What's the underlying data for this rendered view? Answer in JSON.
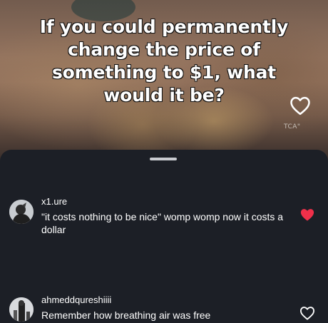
{
  "video": {
    "caption": "If you could permanently change the price of something to $1, what would it be?",
    "watermark": "TCA\"",
    "liked": false
  },
  "comments": [
    {
      "username": "x1.ure",
      "text": "\"it costs nothing to be nice\" womp womp now it costs a dollar",
      "liked": true,
      "like_icon": "heart-filled-icon",
      "like_color": "#f0304a"
    },
    {
      "username": "ahmeddqureshiiii",
      "text": "Remember how breathing air was free",
      "liked": false,
      "like_icon": "heart-outline-icon",
      "like_color": "#ffffff"
    }
  ],
  "theme": {
    "sheet_bg": "#1c1f26",
    "text": "#ffffff",
    "handle": "#c9cbd0"
  }
}
